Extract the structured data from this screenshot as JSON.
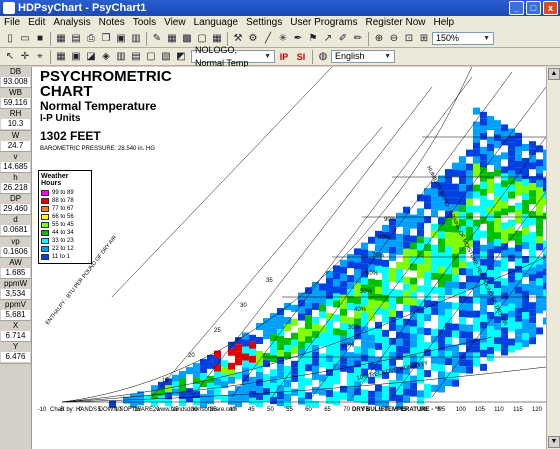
{
  "window": {
    "title": "HDPsyChart - PsyChart1",
    "min": "_",
    "max": "□",
    "close": "x"
  },
  "menu": [
    "File",
    "Edit",
    "Analysis",
    "Notes",
    "Tools",
    "View",
    "Language",
    "Settings",
    "User Programs",
    "Register Now",
    "Help"
  ],
  "toolbar": {
    "chart_combo": "NOLOGO, Normal Temp",
    "ip_label": "IP",
    "si_label": "SI",
    "language_combo": "English",
    "zoom_combo": "150%"
  },
  "readouts": [
    {
      "label": "DB",
      "value": "93.008"
    },
    {
      "label": "WB",
      "value": "59.116"
    },
    {
      "label": "RH",
      "value": "10.3"
    },
    {
      "label": "W",
      "value": "24.7"
    },
    {
      "label": "v",
      "value": "14.685"
    },
    {
      "label": "h",
      "value": "26.218"
    },
    {
      "label": "DP",
      "value": "29.460"
    },
    {
      "label": "d",
      "value": "0.0681"
    },
    {
      "label": "vp",
      "value": "0.1606"
    },
    {
      "label": "AW",
      "value": "1.685"
    },
    {
      "label": "ppmW",
      "value": "3,534"
    },
    {
      "label": "ppmV",
      "value": "5,681"
    },
    {
      "label": "X",
      "value": "6.714"
    },
    {
      "label": "Y",
      "value": "6.476"
    }
  ],
  "chart": {
    "title1": "PSYCHROMETRIC",
    "title2": "CHART",
    "subtitle": "Normal Temperature",
    "units": "I-P Units",
    "elevation": "1302 FEET",
    "pressure": "BAROMETRIC PRESSURE: 28.540 in. HG",
    "enthalpy_label": "ENTHALPY - BTU PER POUND OF DRY AIR",
    "humidity_label": "HUMIDITY RATIO - GRAINS OF MOISTURE PER POUND OF DRY AIR",
    "rh_label": "10% RELATIVE HUMIDITY",
    "xlabel": "DRY BULB TEMPERATURE - °F",
    "credit": "Chart by: HANDS DOWN SOFTWARE, www.handsdownsoftware.com",
    "x_ticks": [
      "-10",
      "-5",
      "0",
      "5",
      "10",
      "15",
      "20",
      "25",
      "30",
      "35",
      "40",
      "45",
      "50",
      "55",
      "60",
      "65",
      "70",
      "75",
      "80",
      "85",
      "90",
      "95",
      "100",
      "105",
      "110",
      "115",
      "120"
    ],
    "enthalpy_ticks": [
      "15",
      "20",
      "25",
      "30",
      "35"
    ],
    "rh_ticks": [
      "20%",
      "30%",
      "40%",
      "50%",
      "60%",
      "70%",
      "80%",
      "90%"
    ]
  },
  "legend": {
    "title": "Weather Hours",
    "items": [
      {
        "label": "99 to 89",
        "color": "#ff00ff"
      },
      {
        "label": "88 to 78",
        "color": "#e00000"
      },
      {
        "label": "77 to 67",
        "color": "#ff7f00"
      },
      {
        "label": "66 to 56",
        "color": "#ffff00"
      },
      {
        "label": "55 to 45",
        "color": "#80ff00"
      },
      {
        "label": "44 to 34",
        "color": "#00c000"
      },
      {
        "label": "33 to 23",
        "color": "#00ffff"
      },
      {
        "label": "22 to 12",
        "color": "#00a0ff"
      },
      {
        "label": "11 to 1",
        "color": "#0040e0"
      }
    ]
  }
}
